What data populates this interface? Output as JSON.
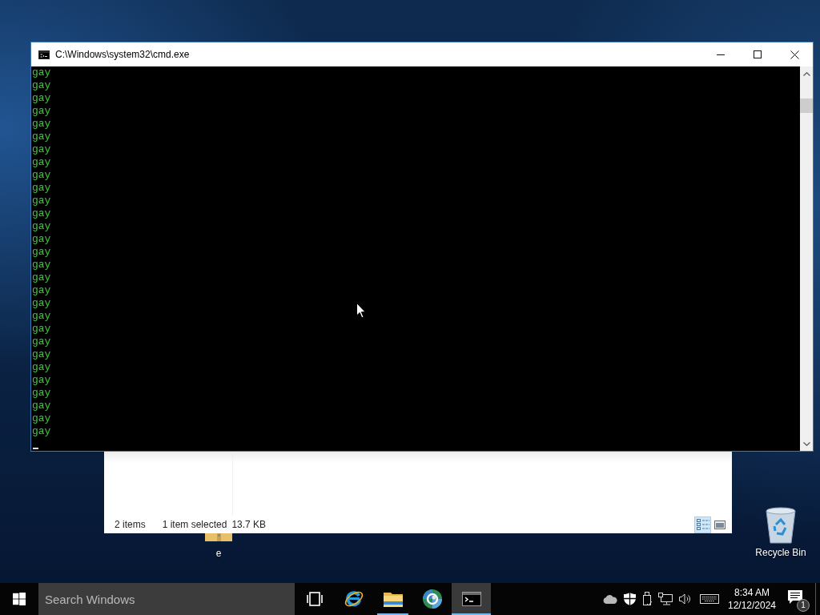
{
  "console_window": {
    "title": "C:\\Windows\\system32\\cmd.exe",
    "lines": [
      "gay",
      "gay",
      "gay",
      "gay",
      "gay",
      "gay",
      "gay",
      "gay",
      "gay",
      "gay",
      "gay",
      "gay",
      "gay",
      "gay",
      "gay",
      "gay",
      "gay",
      "gay",
      "gay",
      "gay",
      "gay",
      "gay",
      "gay",
      "gay",
      "gay",
      "gay",
      "gay",
      "gay",
      "gay"
    ]
  },
  "file_explorer": {
    "status_bar": {
      "item_count": "2 items",
      "selection": "1 item selected",
      "size": "13.7 KB"
    },
    "view_buttons": [
      {
        "kind": "details",
        "selected": true
      },
      {
        "kind": "thumbnails",
        "selected": false
      }
    ]
  },
  "desktop_icons": [
    {
      "kind": "archive",
      "label": "e"
    },
    {
      "kind": "bin",
      "label": "Recycle Bin"
    }
  ],
  "taskbar": {
    "search": {
      "placeholder": "Search Windows"
    },
    "apps": [
      {
        "kind": "browser",
        "running": false,
        "selected": false
      },
      {
        "kind": "explorer",
        "running": true,
        "selected": false
      },
      {
        "kind": "globe",
        "running": false,
        "selected": false
      },
      {
        "kind": "console",
        "running": true,
        "selected": true
      }
    ],
    "tray": {
      "time": "8:34 AM",
      "date": "12/12/2024",
      "notification_count": "1"
    }
  }
}
